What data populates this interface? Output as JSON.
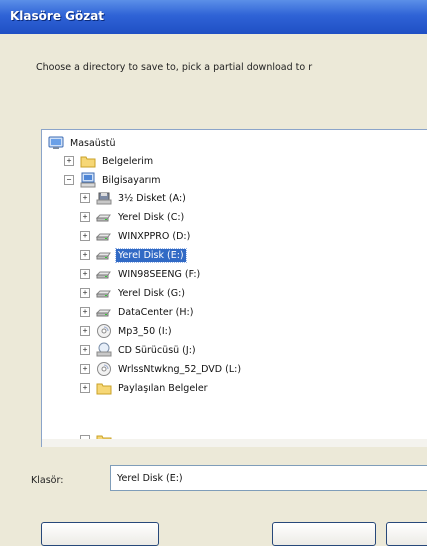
{
  "window": {
    "title": "Klasöre Gözat"
  },
  "instruction": "Choose a directory to save to, pick a partial download to r",
  "tree": {
    "items": [
      {
        "label": "Masaüstü",
        "icon": "desktop-icon",
        "expander": ""
      },
      {
        "label": "Belgelerim",
        "icon": "folder-icon",
        "expander": "+"
      },
      {
        "label": "Bilgisayarım",
        "icon": "computer-icon",
        "expander": "−"
      },
      {
        "label": "3½ Disket (A:)",
        "icon": "floppy-icon",
        "expander": "+"
      },
      {
        "label": "Yerel Disk (C:)",
        "icon": "hard-drive-icon",
        "expander": "+"
      },
      {
        "label": "WINXPPRO (D:)",
        "icon": "hard-drive-icon",
        "expander": "+"
      },
      {
        "label": "Yerel Disk (E:)",
        "icon": "hard-drive-icon",
        "expander": "+",
        "selected": true
      },
      {
        "label": "WIN98SEENG (F:)",
        "icon": "hard-drive-icon",
        "expander": "+"
      },
      {
        "label": "Yerel Disk (G:)",
        "icon": "hard-drive-icon",
        "expander": "+"
      },
      {
        "label": "DataCenter (H:)",
        "icon": "hard-drive-icon",
        "expander": "+"
      },
      {
        "label": "Mp3_50 (I:)",
        "icon": "cd-drive-icon",
        "expander": "+"
      },
      {
        "label": "CD Sürücüsü (J:)",
        "icon": "cd-drive-icon",
        "expander": "+"
      },
      {
        "label": "WrlssNtwkng_52_DVD (L:)",
        "icon": "cd-drive-icon",
        "expander": "+"
      },
      {
        "label": "Paylaşılan Belgeler",
        "icon": "folder-icon",
        "expander": "+"
      }
    ]
  },
  "folder": {
    "label": "Klasör:",
    "value": "Yerel Disk (E:)"
  }
}
